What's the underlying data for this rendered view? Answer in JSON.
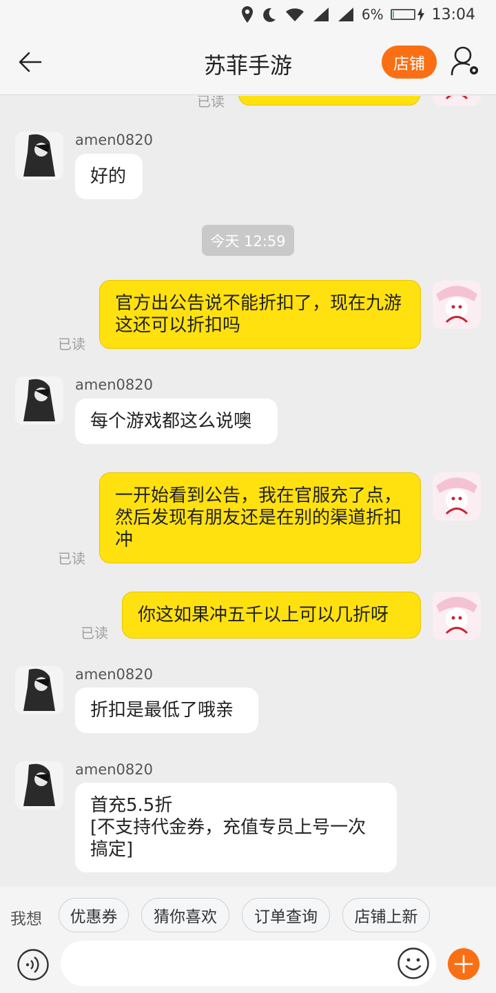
{
  "status_bar": {
    "battery_percent": "6%",
    "battery_level": 0.06,
    "time": "13:04"
  },
  "header": {
    "back_icon": "arrow-left-icon",
    "title": "苏菲手游",
    "shop_label": "店铺",
    "user_icon": "user-settings-icon"
  },
  "chat": {
    "partial_top_read": "已读",
    "time_divider": "今天  12:59",
    "messages": [
      {
        "side": "left",
        "sender": "amen0820",
        "text": "好的"
      },
      {
        "side": "right",
        "text": "官方出公告说不能折扣了，现在九游这还可以折扣吗",
        "read": "已读"
      },
      {
        "side": "left",
        "sender": "amen0820",
        "text": "每个游戏都这么说噢"
      },
      {
        "side": "right",
        "text": "一开始看到公告，我在官服充了点，然后发现有朋友还是在别的渠道折扣冲",
        "read": "已读"
      },
      {
        "side": "right",
        "text": "你这如果冲五千以上可以几折呀",
        "read": "已读"
      },
      {
        "side": "left",
        "sender": "amen0820",
        "text": "折扣是最低了哦亲"
      },
      {
        "side": "left",
        "sender": "amen0820",
        "text": "首充5.5折\n[不支持代金券，充值专员上号一次搞定]"
      }
    ]
  },
  "quick_replies": {
    "label": "我想",
    "items": [
      "优惠券",
      "猜你喜欢",
      "订单查询",
      "店铺上新"
    ]
  },
  "input_bar": {
    "voice_icon": "voice-icon",
    "emoji_icon": "emoji-icon",
    "plus_icon": "plus-icon"
  },
  "colors": {
    "accent": "#fa6f14",
    "my_bubble": "#ffe10f",
    "their_bubble": "#ffffff",
    "background": "#ededed"
  }
}
